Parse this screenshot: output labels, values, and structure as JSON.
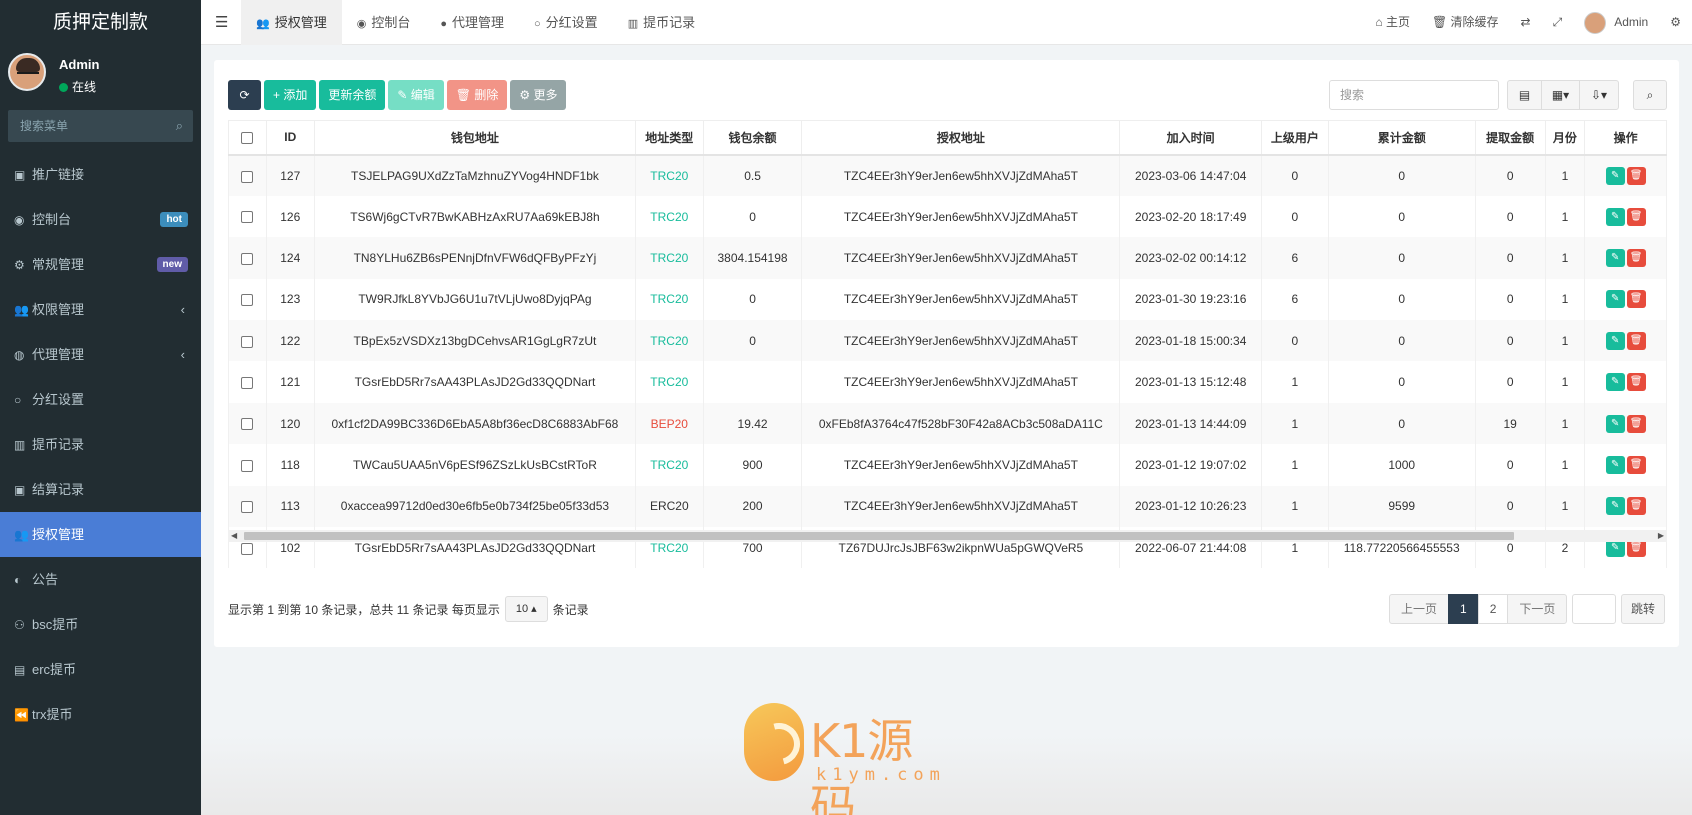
{
  "sidebar": {
    "brand": "质押定制款",
    "user": {
      "name": "Admin",
      "status": "在线"
    },
    "search_placeholder": "搜索菜单",
    "items": [
      {
        "label": "推广链接",
        "icon": "dashboard-icon",
        "glyph": "▣"
      },
      {
        "label": "控制台",
        "icon": "dashboard-icon",
        "glyph": "◉",
        "badge": "hot",
        "badge_color": "#3c8dbc"
      },
      {
        "label": "常规管理",
        "icon": "cogs-icon",
        "glyph": "⚙",
        "badge": "new",
        "badge_color": "#605ca8"
      },
      {
        "label": "权限管理",
        "icon": "group-icon",
        "glyph": "👥",
        "arrow": "‹"
      },
      {
        "label": "代理管理",
        "icon": "user-circle-icon",
        "glyph": "◍",
        "arrow": "‹"
      },
      {
        "label": "分红设置",
        "icon": "circle-icon",
        "glyph": "○"
      },
      {
        "label": "提币记录",
        "icon": "bar-chart-icon",
        "glyph": "▥"
      },
      {
        "label": "结算记录",
        "icon": "dashboard-icon",
        "glyph": "▣"
      },
      {
        "label": "授权管理",
        "icon": "group-icon",
        "glyph": "👥",
        "active": true
      },
      {
        "label": "公告",
        "icon": "adjust-icon",
        "glyph": "◐"
      },
      {
        "label": "bsc提币",
        "icon": "bicycle-icon",
        "glyph": "⚇"
      },
      {
        "label": "erc提币",
        "icon": "briefcase-icon",
        "glyph": "▤"
      },
      {
        "label": "trx提币",
        "icon": "backward-icon",
        "glyph": "⏪"
      }
    ]
  },
  "topbar": {
    "tabs": [
      {
        "label": "授权管理",
        "glyph": "👥",
        "active": true
      },
      {
        "label": "控制台",
        "glyph": "◉"
      },
      {
        "label": "代理管理",
        "glyph": "●"
      },
      {
        "label": "分红设置",
        "glyph": "○"
      },
      {
        "label": "提币记录",
        "glyph": "▥"
      }
    ],
    "home": "主页",
    "clear_cache": "清除缓存",
    "admin": "Admin"
  },
  "toolbar": {
    "add": "添加",
    "update_balance": "更新余额",
    "edit": "编辑",
    "delete": "删除",
    "more": "更多",
    "search_placeholder": "搜索"
  },
  "table": {
    "headers": [
      "ID",
      "钱包地址",
      "地址类型",
      "钱包余额",
      "授权地址",
      "加入时间",
      "上级用户",
      "累计金额",
      "提取金额",
      "月份",
      "操作"
    ],
    "rows": [
      [
        "127",
        "TSJELPAG9UXdZzTaMzhnuZYVog4HNDF1bk",
        "TRC20",
        "0.5",
        "TZC4EEr3hY9erJen6ew5hhXVJjZdMAha5T",
        "2023-03-06 14:47:04",
        "0",
        "0",
        "0",
        "1"
      ],
      [
        "126",
        "TS6Wj6gCTvR7BwKABHzAxRU7Aa69kEBJ8h",
        "TRC20",
        "0",
        "TZC4EEr3hY9erJen6ew5hhXVJjZdMAha5T",
        "2023-02-20 18:17:49",
        "0",
        "0",
        "0",
        "1"
      ],
      [
        "124",
        "TN8YLHu6ZB6sPENnjDfnVFW6dQFByPFzYj",
        "TRC20",
        "3804.154198",
        "TZC4EEr3hY9erJen6ew5hhXVJjZdMAha5T",
        "2023-02-02 00:14:12",
        "6",
        "0",
        "0",
        "1"
      ],
      [
        "123",
        "TW9RJfkL8YVbJG6U1u7tVLjUwo8DyjqPAg",
        "TRC20",
        "0",
        "TZC4EEr3hY9erJen6ew5hhXVJjZdMAha5T",
        "2023-01-30 19:23:16",
        "6",
        "0",
        "0",
        "1"
      ],
      [
        "122",
        "TBpEx5zVSDXz13bgDCehvsAR1GgLgR7zUt",
        "TRC20",
        "0",
        "TZC4EEr3hY9erJen6ew5hhXVJjZdMAha5T",
        "2023-01-18 15:00:34",
        "0",
        "0",
        "0",
        "1"
      ],
      [
        "121",
        "TGsrEbD5Rr7sAA43PLAsJD2Gd33QQDNart",
        "TRC20",
        "",
        "TZC4EEr3hY9erJen6ew5hhXVJjZdMAha5T",
        "2023-01-13 15:12:48",
        "1",
        "0",
        "0",
        "1"
      ],
      [
        "120",
        "0xf1cf2DA99BC336D6EbA5A8bf36ecD8C6883AbF68",
        "BEP20",
        "19.42",
        "0xFEb8fA3764c47f528bF30F42a8ACb3c508aDA11C",
        "2023-01-13 14:44:09",
        "1",
        "0",
        "19",
        "1"
      ],
      [
        "118",
        "TWCau5UAA5nV6pESf96ZSzLkUsBCstRToR",
        "TRC20",
        "900",
        "TZC4EEr3hY9erJen6ew5hhXVJjZdMAha5T",
        "2023-01-12 19:07:02",
        "1",
        "1000",
        "0",
        "1"
      ],
      [
        "113",
        "0xaccea99712d0ed30e6fb5e0b734f25be05f33d53",
        "ERC20",
        "200",
        "TZC4EEr3hY9erJen6ew5hhXVJjZdMAha5T",
        "2023-01-12 10:26:23",
        "1",
        "9599",
        "0",
        "1"
      ],
      [
        "102",
        "TGsrEbD5Rr7sAA43PLAsJD2Gd33QQDNart",
        "TRC20",
        "700",
        "TZ67DUJrcJsJBF63w2ikpnWUa5pGWQVeR5",
        "2022-06-07 21:44:08",
        "1",
        "118.77220566455553",
        "0",
        "2"
      ]
    ]
  },
  "pagination": {
    "info_prefix": "显示第 1 到第 10 条记录，总共 11 条记录 每页显示",
    "page_size": "10",
    "info_suffix": "条记录",
    "prev": "上一页",
    "pages": [
      "1",
      "2"
    ],
    "next": "下一页",
    "go": "跳转"
  },
  "watermark": {
    "text": "K1源码",
    "sub": "k1ym.com"
  },
  "colors": {
    "sidebar_bg": "#222d32",
    "active_menu": "#4a7dd6",
    "trc20": "#18bc9c",
    "bep20": "#e74c3c"
  }
}
